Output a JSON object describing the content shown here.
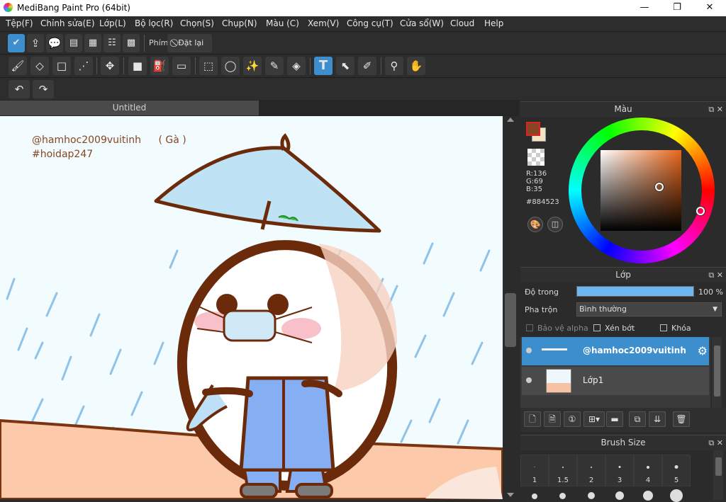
{
  "window": {
    "title": "MediBang Paint Pro (64bit)",
    "minimize": "—",
    "maximize": "❐",
    "close": "✕"
  },
  "menu": [
    "Tệp(F)",
    "Chỉnh sửa(E)",
    "Lớp(L)",
    "Bộ lọc(R)",
    "Chọn(S)",
    "Chụp(N)",
    "Màu (C)",
    "Xem(V)",
    "Công cụ(T)",
    "Cửa sổ(W)",
    "Cloud",
    "Help"
  ],
  "toolbar1": {
    "phim_label": "Phím",
    "reset_label": "Đặt lại"
  },
  "tab": {
    "label": "Untitled"
  },
  "canvas": {
    "line1": "@hamhoc2009vuitinh",
    "line1_extra": "( Gà )",
    "line2": "#hoidap247"
  },
  "color_panel": {
    "title": "Màu",
    "r": "R:136",
    "g": "G:69",
    "b": "B:35",
    "hex": "#884523",
    "fg": "#884523",
    "bg": "#f5e3c3"
  },
  "layer_panel": {
    "title": "Lớp",
    "opacity_label": "Độ trong",
    "opacity_value": "100 %",
    "opacity_fraction": 1.0,
    "blend_label": "Pha trộn",
    "blend_value": "Bình thường",
    "protect_alpha": "Bảo vệ alpha",
    "clip": "Xén bớt",
    "lock": "Khóa",
    "layers": [
      {
        "name": "@hamhoc2009vuitinh",
        "selected": true
      },
      {
        "name": "Lớp1",
        "selected": false
      }
    ]
  },
  "brush_panel": {
    "title": "Brush Size",
    "sizes": [
      "1",
      "1.5",
      "2",
      "3",
      "4",
      "5"
    ]
  }
}
